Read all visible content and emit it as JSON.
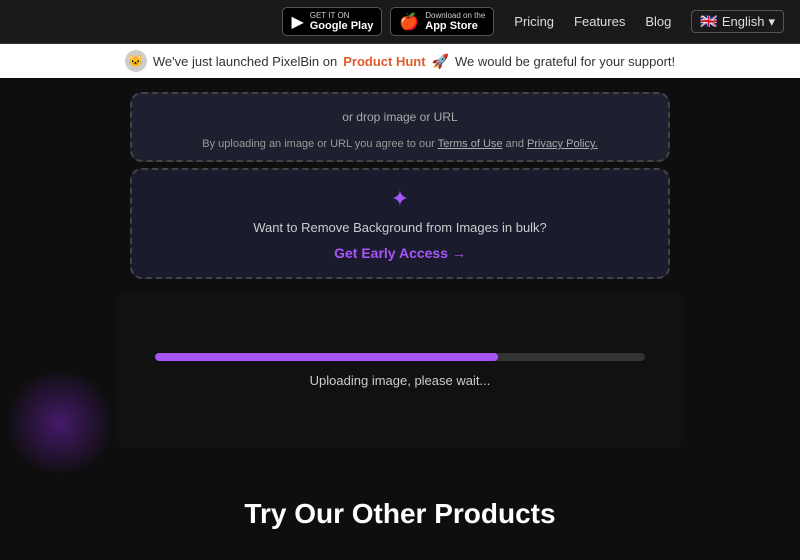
{
  "navbar": {
    "google_play": {
      "get_it_on": "GET IT ON",
      "store_name": "Google Play"
    },
    "app_store": {
      "download_on": "Download on the",
      "store_name": "App Store"
    },
    "links": {
      "pricing": "Pricing",
      "features": "Features",
      "blog": "Blog",
      "language": "English"
    }
  },
  "announcement": {
    "text_before": "We've just launched  PixelBin on",
    "link_text": "Product Hunt",
    "emoji": "🚀",
    "text_after": "We would be grateful for your support!"
  },
  "upload": {
    "drop_text": "or drop image or URL",
    "terms_text": "By uploading an image or URL you agree to our",
    "terms_link": "Terms of Use",
    "and": "and",
    "privacy_link": "Privacy Policy."
  },
  "bulk": {
    "icon": "✦",
    "text": "Want to Remove Background from Images in bulk?",
    "cta": "Get Early Access →"
  },
  "progress": {
    "bar_percent": 70,
    "label": "Uploading image, please wait..."
  },
  "other_products": {
    "title": "Try Our Other Products"
  },
  "colors": {
    "purple": "#a855f7",
    "dark_bg": "#0e0e0e"
  }
}
